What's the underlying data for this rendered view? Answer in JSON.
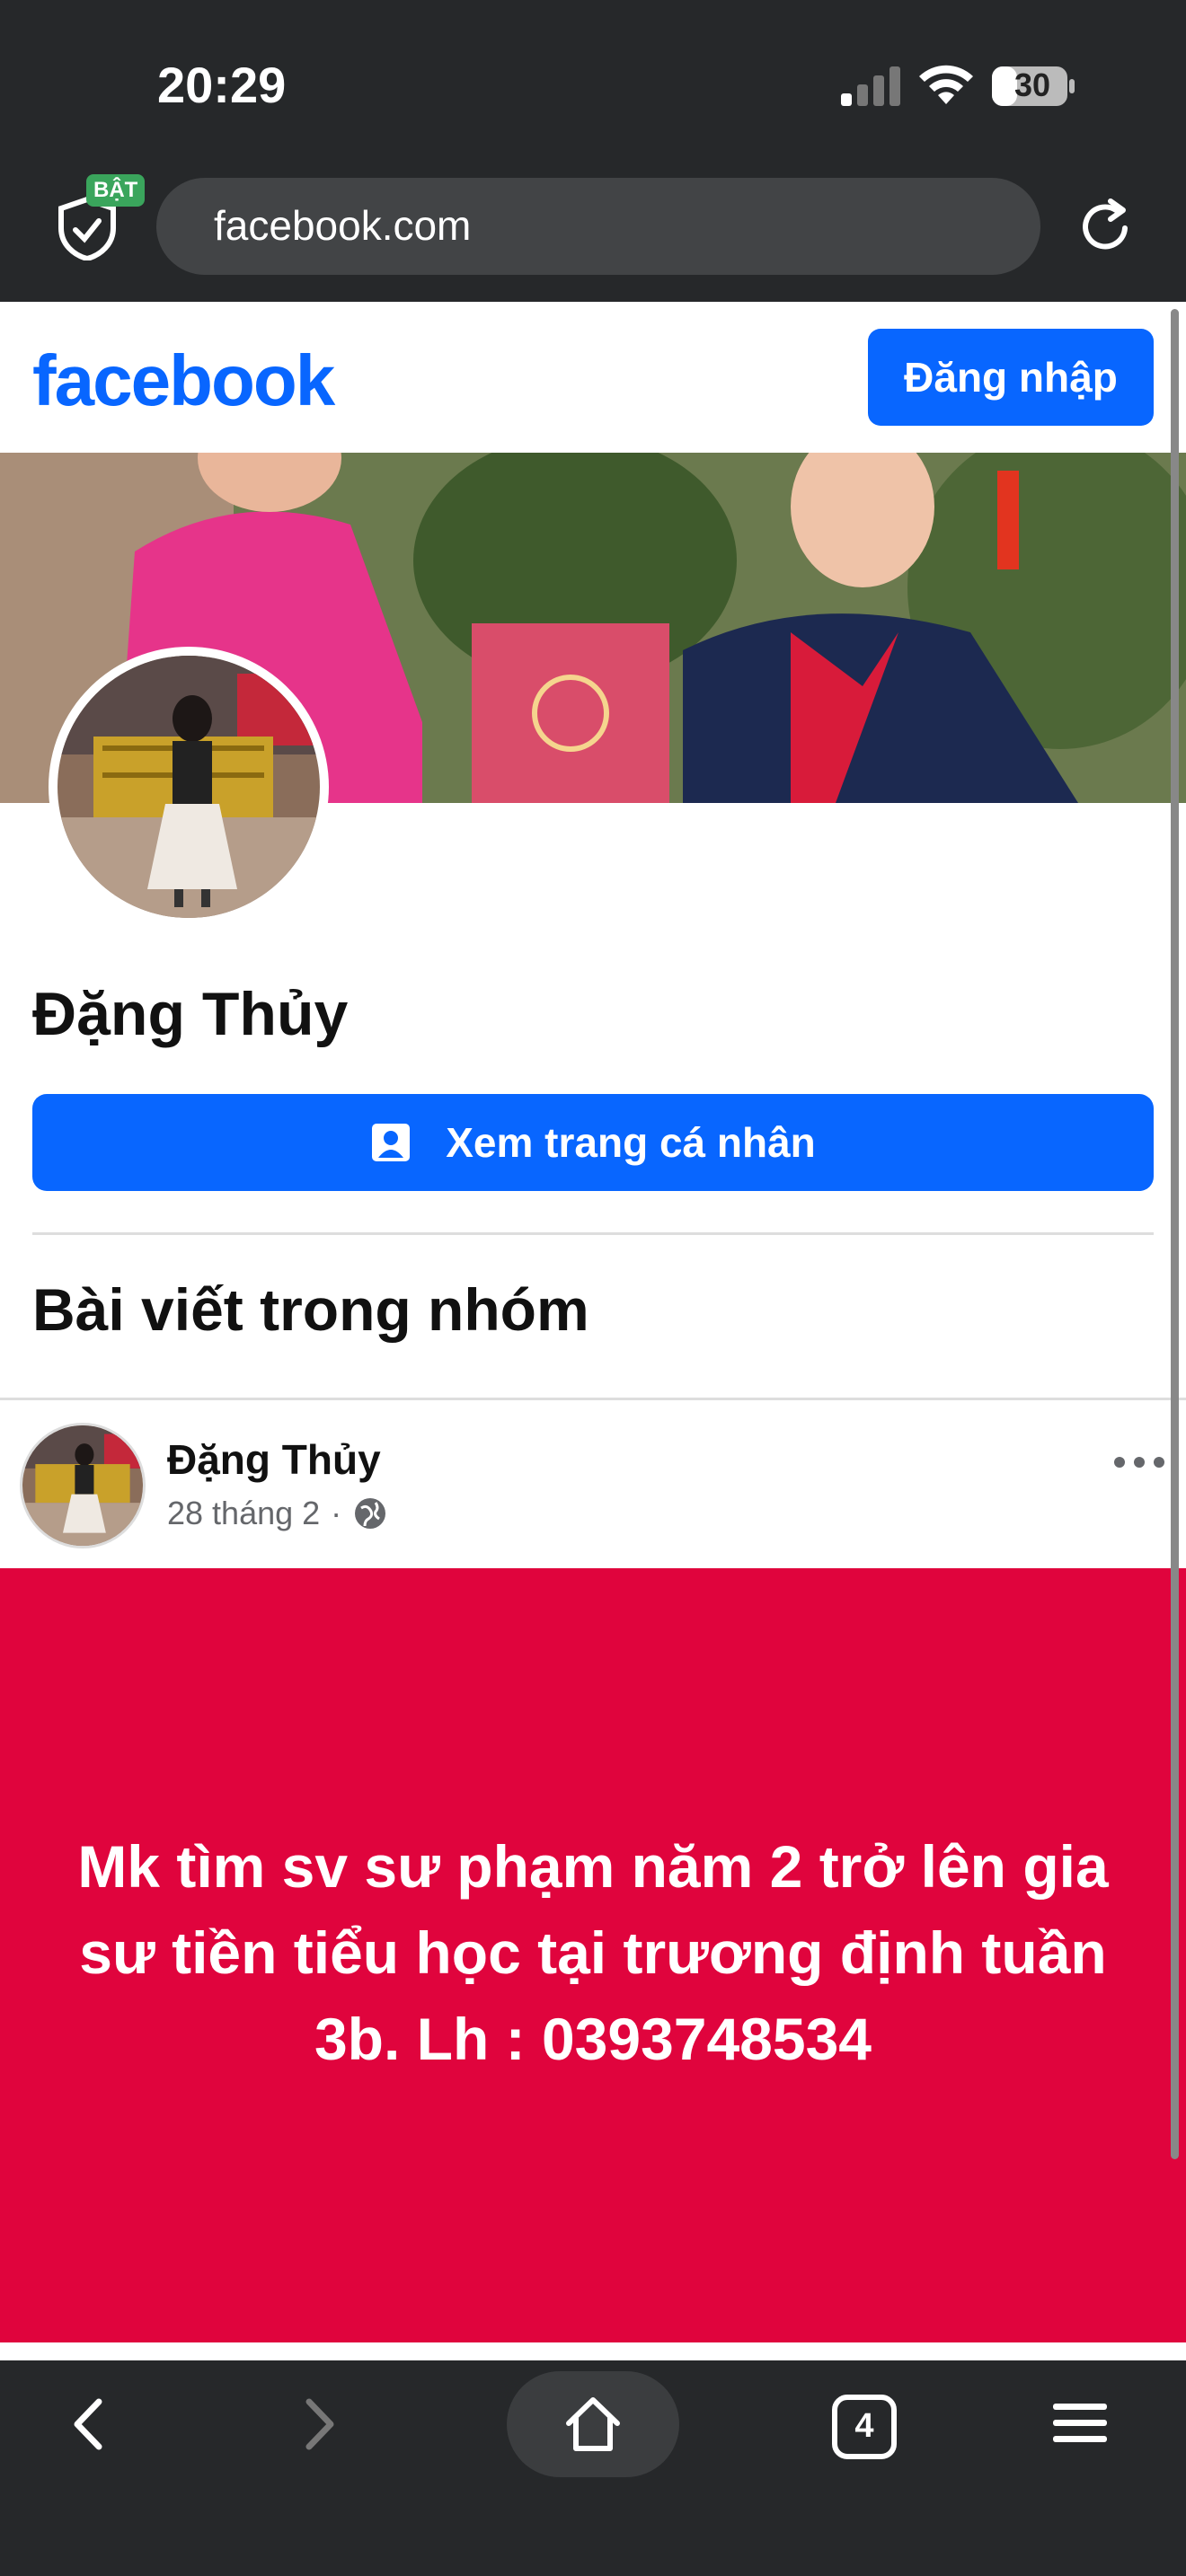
{
  "status_bar": {
    "time": "20:29",
    "battery": "30"
  },
  "browser": {
    "url": "facebook.com",
    "shield_badge": "BẬT",
    "tabs_count": "4"
  },
  "header": {
    "logo": "facebook",
    "login_label": "Đăng nhập"
  },
  "profile": {
    "name": "Đặng Thủy",
    "view_profile_label": "Xem trang cá nhân"
  },
  "section": {
    "title": "Bài viết trong nhóm"
  },
  "post": {
    "author": "Đặng Thủy",
    "date": "28 tháng 2",
    "separator": "·",
    "text": "Mk tìm sv sư phạm năm 2 trở lên gia sư tiền tiểu học tại trương định tuần 3b. Lh : 0393748534"
  },
  "colors": {
    "brand": "#0866ff",
    "post_bg": "#e0043d",
    "chrome": "#26282a"
  },
  "icons": [
    "signal-icon",
    "wifi-icon",
    "battery-icon",
    "shield-icon",
    "reload-icon",
    "profile-card-icon",
    "globe-icon",
    "more-icon",
    "back-icon",
    "forward-icon",
    "home-icon",
    "tabs-icon",
    "menu-icon"
  ]
}
